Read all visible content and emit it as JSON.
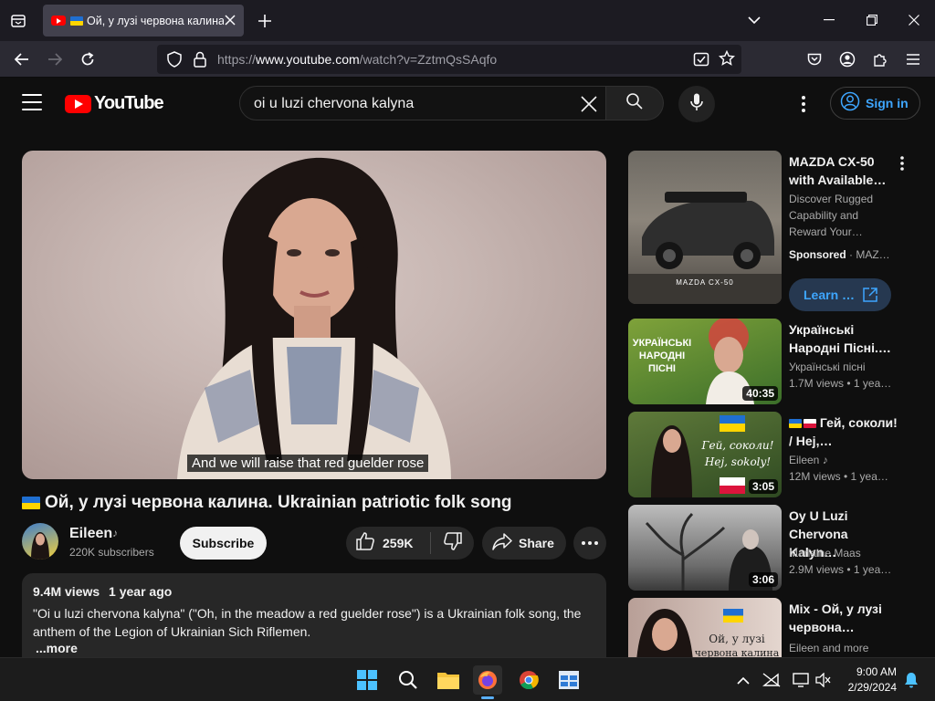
{
  "browser": {
    "tab_title": "Ой, у лузі червона калина. Ukrainian patriotic folk song",
    "url_prefix": "https://",
    "url_host": "www.youtube.com",
    "url_path": "/watch?v=ZztmQsSAqfo"
  },
  "youtube": {
    "logo_text": "YouTube",
    "search_query": "oi u luzi chervona kalyna",
    "sign_in_label": "Sign in"
  },
  "video": {
    "caption": "And we will raise that red guelder rose",
    "title": "Ой, у лузі червона калина. Ukrainian patriotic folk song",
    "channel_name": "Eileen",
    "subscribers": "220K subscribers",
    "subscribe_label": "Subscribe",
    "likes": "259K",
    "share_label": "Share",
    "views": "9.4M views",
    "age": "1 year ago",
    "description": "\"Oi u luzi chervona kalyna\" (\"Oh, in the meadow a red guelder rose\") is a Ukrainian folk song, the anthem of the Legion of Ukrainian Sich Riflemen.",
    "more_label": "...more"
  },
  "sidebar": {
    "ad": {
      "title": "MAZDA CX-50 with Available…",
      "desc": "Discover Rugged Capability and Reward Your…",
      "sponsored": "Sponsored",
      "advertiser": "MAZ…",
      "learn_label": "Learn …",
      "thumb_caption": "MAZDA CX-50"
    },
    "items": [
      {
        "title": "Українські Народні Пісні.…",
        "channel": "Українські пісні",
        "meta": "1.7M views • 1 yea…",
        "duration": "40:35",
        "thumb_text": "УКРАЇНСЬКІ НАРОДНІ ПІСНІ"
      },
      {
        "title": "Гей, соколи! / Hej,…",
        "channel": "Eileen",
        "meta": "12M views • 1 yea…",
        "duration": "3:05",
        "thumb_text_1": "Гей, соколи!",
        "thumb_text_2": "Hej, sokoly!"
      },
      {
        "title": "Oy U Luzi Chervona Kalyn…",
        "channel": "Marlaine Maas",
        "meta": "2.9M views • 1 yea…",
        "duration": "3:06"
      },
      {
        "title": "Mix - Ой, у лузі червона…",
        "channel": "Eileen and more",
        "thumb_text_1": "Ой, у лузі",
        "thumb_text_2": "червона калина"
      }
    ]
  },
  "taskbar": {
    "time": "9:00 AM",
    "date": "2/29/2024"
  },
  "icons": {
    "tab_favicon": "youtube-icon",
    "mic": "microphone-icon",
    "search": "search-icon"
  },
  "colors": {
    "yt_red": "#ff0000",
    "link_blue": "#3ea6ff",
    "background": "#0f0f0f"
  }
}
